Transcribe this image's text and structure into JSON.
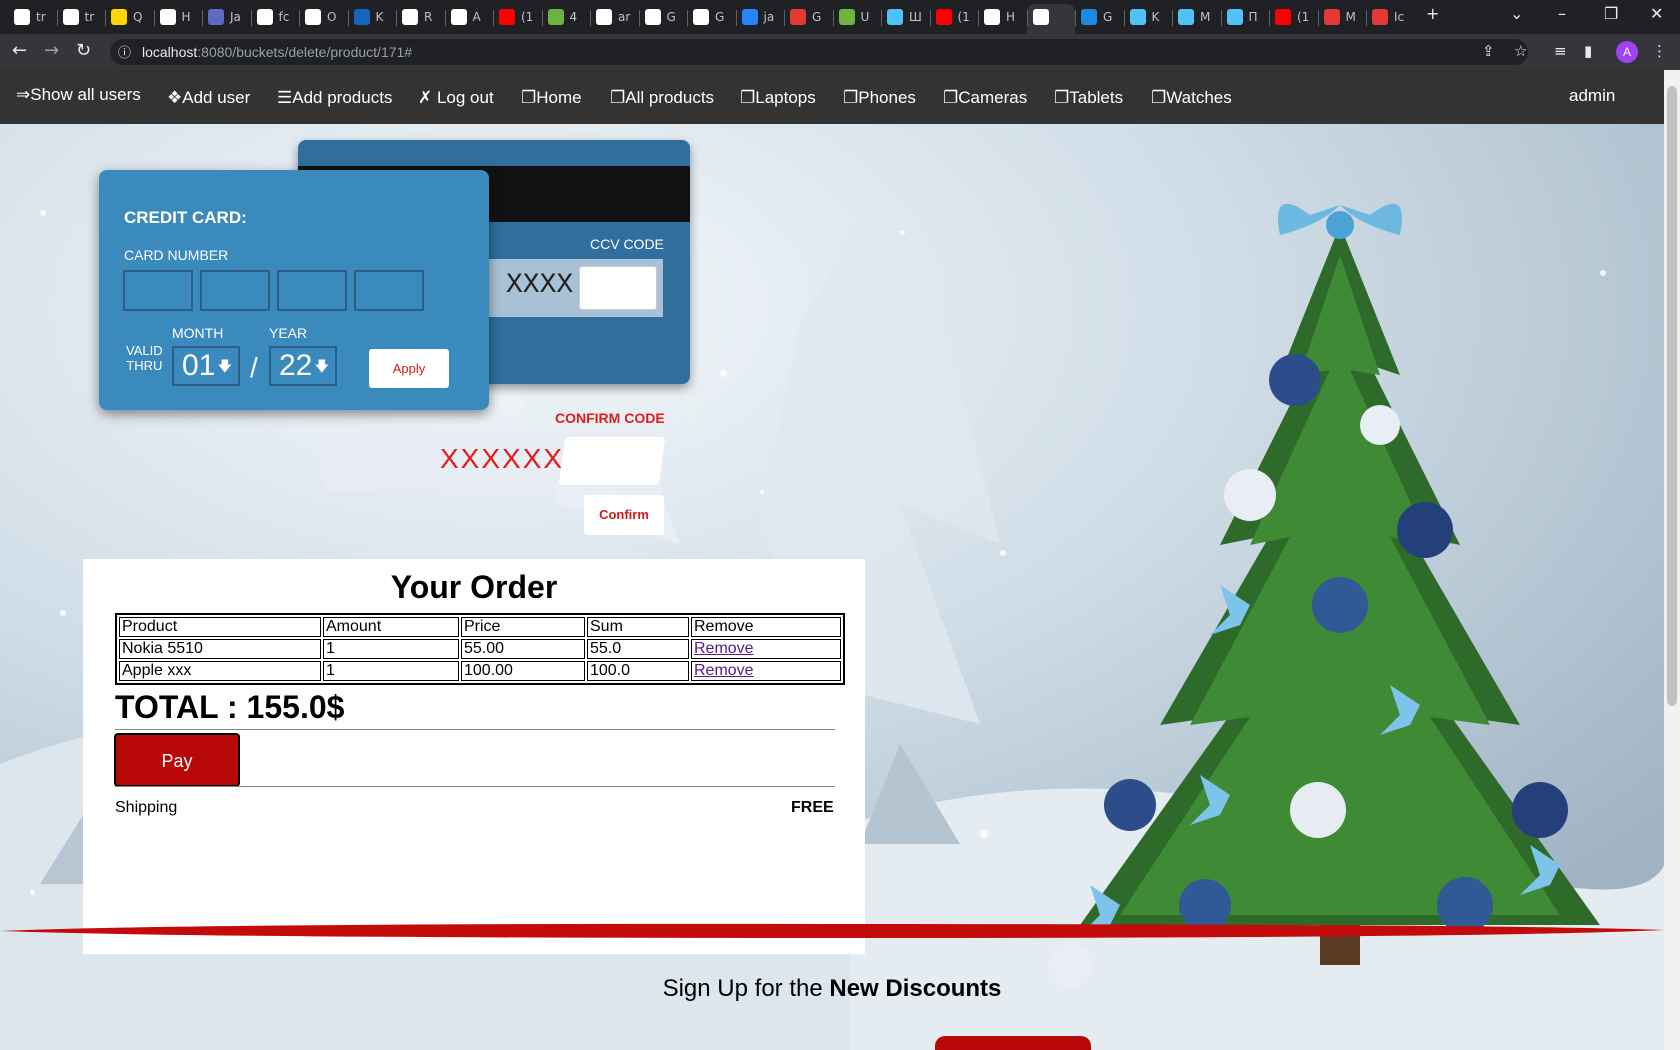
{
  "browser": {
    "tabs": [
      {
        "label": "tr",
        "icon": "google-icon"
      },
      {
        "label": "tr",
        "icon": "google-icon"
      },
      {
        "label": "Q",
        "icon": "qlik-icon"
      },
      {
        "label": "H",
        "icon": "github-icon"
      },
      {
        "label": "Ja",
        "icon": "java-icon"
      },
      {
        "label": "fc",
        "icon": "github-icon"
      },
      {
        "label": "O",
        "icon": "d-icon"
      },
      {
        "label": "K",
        "icon": "k-icon"
      },
      {
        "label": "R",
        "icon": "github-icon"
      },
      {
        "label": "A",
        "icon": "github-icon"
      },
      {
        "label": "(1",
        "icon": "youtube-icon"
      },
      {
        "label": "4",
        "icon": "spring-icon"
      },
      {
        "label": "ar",
        "icon": "github-icon"
      },
      {
        "label": "G",
        "icon": "github-icon"
      },
      {
        "label": "G",
        "icon": "github-icon"
      },
      {
        "label": "ja",
        "icon": "jira-icon"
      },
      {
        "label": "G",
        "icon": "tab-icon"
      },
      {
        "label": "U",
        "icon": "spring-icon"
      },
      {
        "label": "Ш",
        "icon": "app-icon"
      },
      {
        "label": "(1",
        "icon": "youtube-icon"
      },
      {
        "label": "H",
        "icon": "github-icon"
      },
      {
        "label": "",
        "icon": "github-icon"
      },
      {
        "label": "G",
        "icon": "cl-icon"
      },
      {
        "label": "K",
        "icon": "app-icon"
      },
      {
        "label": "M",
        "icon": "app-icon"
      },
      {
        "label": "П",
        "icon": "app-icon"
      },
      {
        "label": "(1",
        "icon": "youtube-icon"
      },
      {
        "label": "M",
        "icon": "tab-icon"
      },
      {
        "label": "Ic",
        "icon": "tab-icon"
      }
    ],
    "url_host": "localhost",
    "url_path": ":8080/buckets/delete/product/171#",
    "avatar_letter": "A"
  },
  "navbar": {
    "show_all_users": "⇒Show all users",
    "add_user": "❖Add user",
    "add_products": "☰Add products",
    "log_out": "✗ Log out",
    "home": "❐Home",
    "all_products": "❐All products",
    "laptops": "❐Laptops",
    "phones": "❐Phones",
    "cameras": "❐Cameras",
    "tablets": "❐Tablets",
    "watches": "❐Watches",
    "user": "admin"
  },
  "card": {
    "title": "CREDIT CARD:",
    "card_number_label": "CARD NUMBER",
    "month_label": "MONTH",
    "year_label": "YEAR",
    "valid_line1": "VALID",
    "valid_line2": "THRU",
    "month_value": "01",
    "year_value": "22",
    "slash": "/",
    "apply_label": "Apply",
    "ccv_label": "CCV CODE",
    "ccv_mask": "XXXX"
  },
  "confirm": {
    "label": "CONFIRM CODE",
    "mask": "XXXXXX",
    "button_label": "Confirm"
  },
  "order": {
    "title": "Your Order",
    "columns": [
      "Product",
      "Amount",
      "Price",
      "Sum",
      "Remove"
    ],
    "rows": [
      {
        "product": "Nokia 5510",
        "amount": "1",
        "price": "55.00",
        "sum": "55.0",
        "remove": "Remove"
      },
      {
        "product": "Apple xxx",
        "amount": "1",
        "price": "100.00",
        "sum": "100.0",
        "remove": "Remove"
      }
    ],
    "total": "TOTAL : 155.0$",
    "pay_label": "Pay",
    "shipping_label": "Shipping",
    "shipping_value": "FREE"
  },
  "signup": {
    "prefix": "Sign Up for the ",
    "bold": "New Discounts"
  },
  "colors": {
    "navbar_bg": "#333333",
    "card_front": "#3a8abd",
    "card_back": "#2f6e9d",
    "accent_red": "#b80707"
  }
}
